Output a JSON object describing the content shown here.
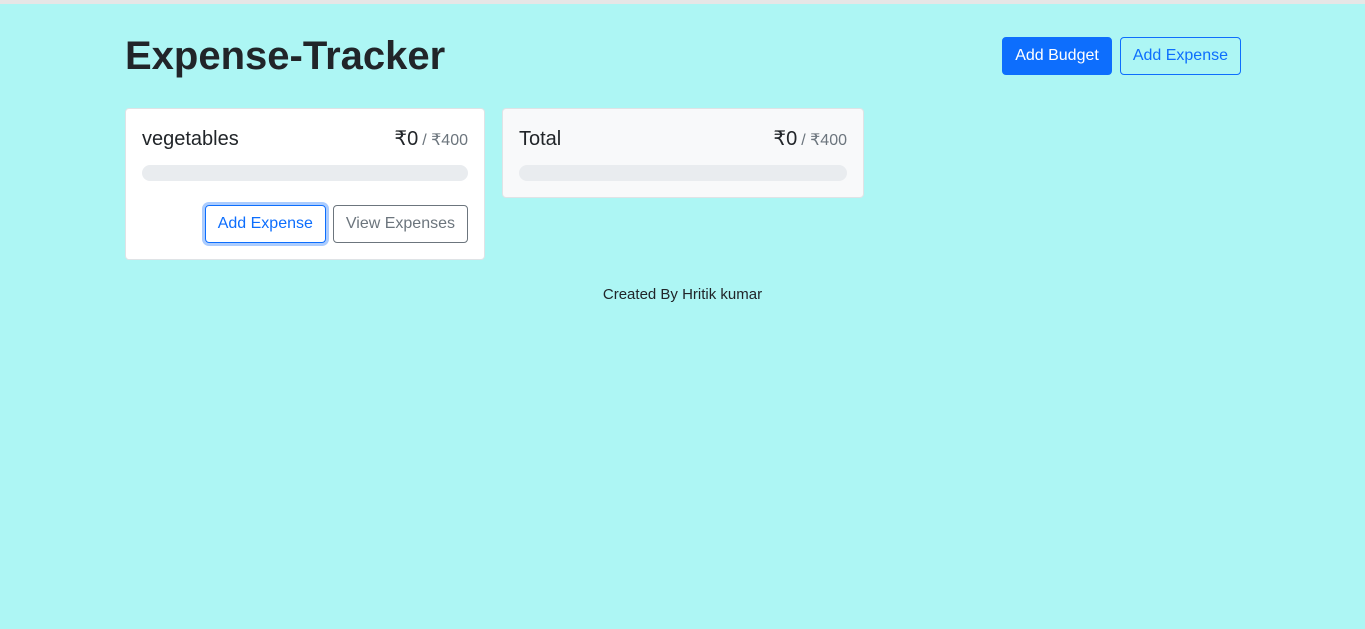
{
  "app": {
    "title": "Expense-Tracker"
  },
  "header": {
    "add_budget_label": "Add Budget",
    "add_expense_label": "Add Expense"
  },
  "budgets": [
    {
      "name": "vegetables",
      "amount": "₹0",
      "max": "/ ₹400",
      "progress_fraction": 0,
      "add_expense_label": "Add Expense",
      "view_expenses_label": "View Expenses"
    }
  ],
  "total": {
    "name": "Total",
    "amount": "₹0",
    "max": "/ ₹400",
    "progress_fraction": 0
  },
  "footer": {
    "text": "Created By Hritik kumar"
  },
  "colors": {
    "background": "#adf6f4",
    "primary": "#0d6efd",
    "secondary": "#6c757d"
  }
}
